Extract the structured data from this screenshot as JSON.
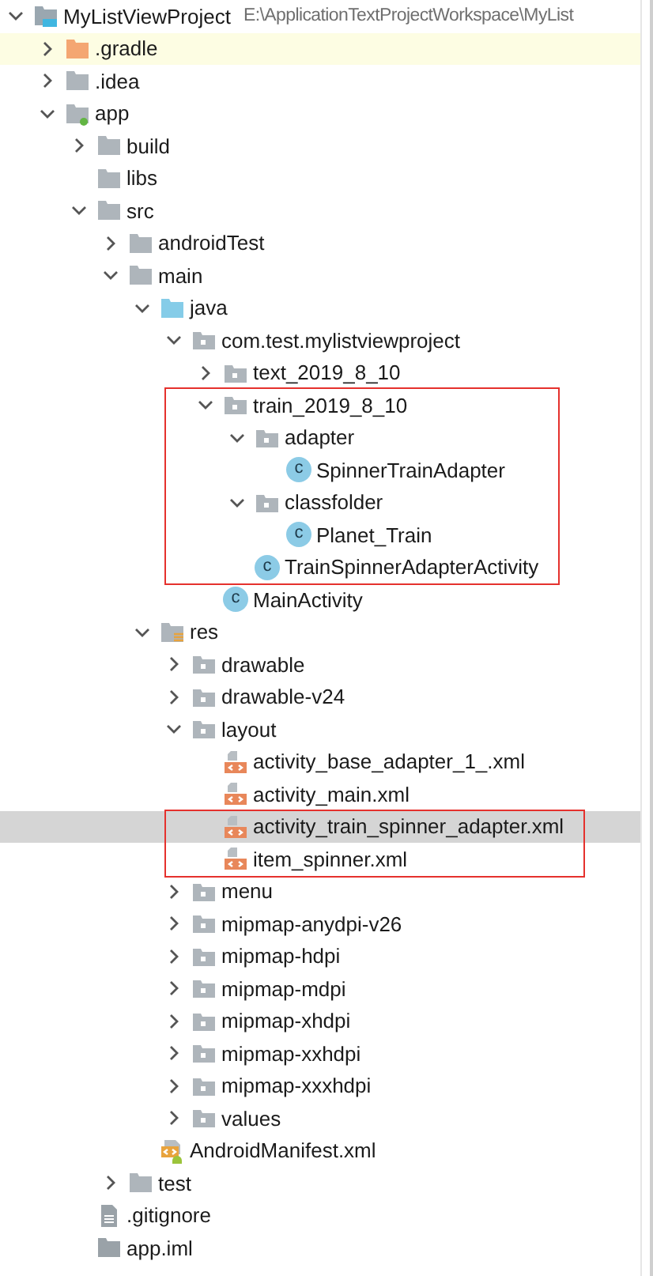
{
  "project": {
    "label": "MyListViewProject",
    "path": "E:\\ApplicationTextProjectWorkspace\\MyList",
    "kind": "project",
    "expanded": true,
    "selected": false,
    "children": [
      {
        "label": ".gradle",
        "kind": "excluded",
        "expanded": false,
        "selected": false,
        "highlighted": true
      },
      {
        "label": ".idea",
        "kind": "folder",
        "expanded": false,
        "selected": false
      },
      {
        "label": "app",
        "kind": "module",
        "expanded": true,
        "selected": false,
        "children": [
          {
            "label": "build",
            "kind": "folder",
            "expanded": false,
            "selected": false
          },
          {
            "label": "libs",
            "kind": "folder",
            "selected": false
          },
          {
            "label": "src",
            "kind": "folder",
            "expanded": true,
            "selected": false,
            "children": [
              {
                "label": "androidTest",
                "kind": "folder",
                "expanded": false,
                "selected": false
              },
              {
                "label": "main",
                "kind": "folder",
                "expanded": true,
                "selected": false,
                "children": [
                  {
                    "label": "java",
                    "kind": "java-source",
                    "expanded": true,
                    "selected": false,
                    "children": [
                      {
                        "label": "com.test.mylistviewproject",
                        "kind": "package",
                        "expanded": true,
                        "selected": false,
                        "children": [
                          {
                            "label": "text_2019_8_10",
                            "kind": "package",
                            "expanded": false,
                            "selected": false
                          },
                          {
                            "label": "train_2019_8_10",
                            "kind": "package",
                            "expanded": true,
                            "selected": false,
                            "outlined": true,
                            "children": [
                              {
                                "label": "adapter",
                                "kind": "package",
                                "expanded": true,
                                "selected": false,
                                "children": [
                                  {
                                    "label": "SpinnerTrainAdapter",
                                    "kind": "class",
                                    "badge": "c",
                                    "selected": false
                                  }
                                ]
                              },
                              {
                                "label": "classfolder",
                                "kind": "package",
                                "expanded": true,
                                "selected": false,
                                "children": [
                                  {
                                    "label": "Planet_Train",
                                    "kind": "class",
                                    "badge": "c",
                                    "selected": false
                                  }
                                ]
                              },
                              {
                                "label": "TrainSpinnerAdapterActivity",
                                "kind": "class",
                                "badge": "c",
                                "selected": false
                              }
                            ]
                          },
                          {
                            "label": "MainActivity",
                            "kind": "class",
                            "badge": "c",
                            "selected": false
                          }
                        ]
                      }
                    ]
                  },
                  {
                    "label": "res",
                    "kind": "resources",
                    "expanded": true,
                    "selected": false,
                    "children": [
                      {
                        "label": "drawable",
                        "kind": "package",
                        "expanded": false,
                        "selected": false
                      },
                      {
                        "label": "drawable-v24",
                        "kind": "package",
                        "expanded": false,
                        "selected": false
                      },
                      {
                        "label": "layout",
                        "kind": "package",
                        "expanded": true,
                        "selected": false,
                        "children": [
                          {
                            "label": "activity_base_adapter_1_.xml",
                            "kind": "layout-xml",
                            "selected": false
                          },
                          {
                            "label": "activity_main.xml",
                            "kind": "layout-xml",
                            "selected": false
                          },
                          {
                            "label": "activity_train_spinner_adapter.xml",
                            "kind": "layout-xml",
                            "selected": true,
                            "outlined": true
                          },
                          {
                            "label": "item_spinner.xml",
                            "kind": "layout-xml",
                            "selected": false,
                            "outlined": true
                          }
                        ]
                      },
                      {
                        "label": "menu",
                        "kind": "package",
                        "expanded": false,
                        "selected": false
                      },
                      {
                        "label": "mipmap-anydpi-v26",
                        "kind": "package",
                        "expanded": false,
                        "selected": false
                      },
                      {
                        "label": "mipmap-hdpi",
                        "kind": "package",
                        "expanded": false,
                        "selected": false
                      },
                      {
                        "label": "mipmap-mdpi",
                        "kind": "package",
                        "expanded": false,
                        "selected": false
                      },
                      {
                        "label": "mipmap-xhdpi",
                        "kind": "package",
                        "expanded": false,
                        "selected": false
                      },
                      {
                        "label": "mipmap-xxhdpi",
                        "kind": "package",
                        "expanded": false,
                        "selected": false
                      },
                      {
                        "label": "mipmap-xxxhdpi",
                        "kind": "package",
                        "expanded": false,
                        "selected": false
                      },
                      {
                        "label": "values",
                        "kind": "package",
                        "expanded": false,
                        "selected": false
                      }
                    ]
                  },
                  {
                    "label": "AndroidManifest.xml",
                    "kind": "manifest",
                    "selected": false
                  }
                ]
              },
              {
                "label": "test",
                "kind": "folder",
                "expanded": false,
                "selected": false
              }
            ]
          },
          {
            "label": ".gitignore",
            "kind": "text-file",
            "selected": false
          },
          {
            "label": "app.iml",
            "kind": "module-file",
            "selected": false
          }
        ]
      }
    ]
  }
}
